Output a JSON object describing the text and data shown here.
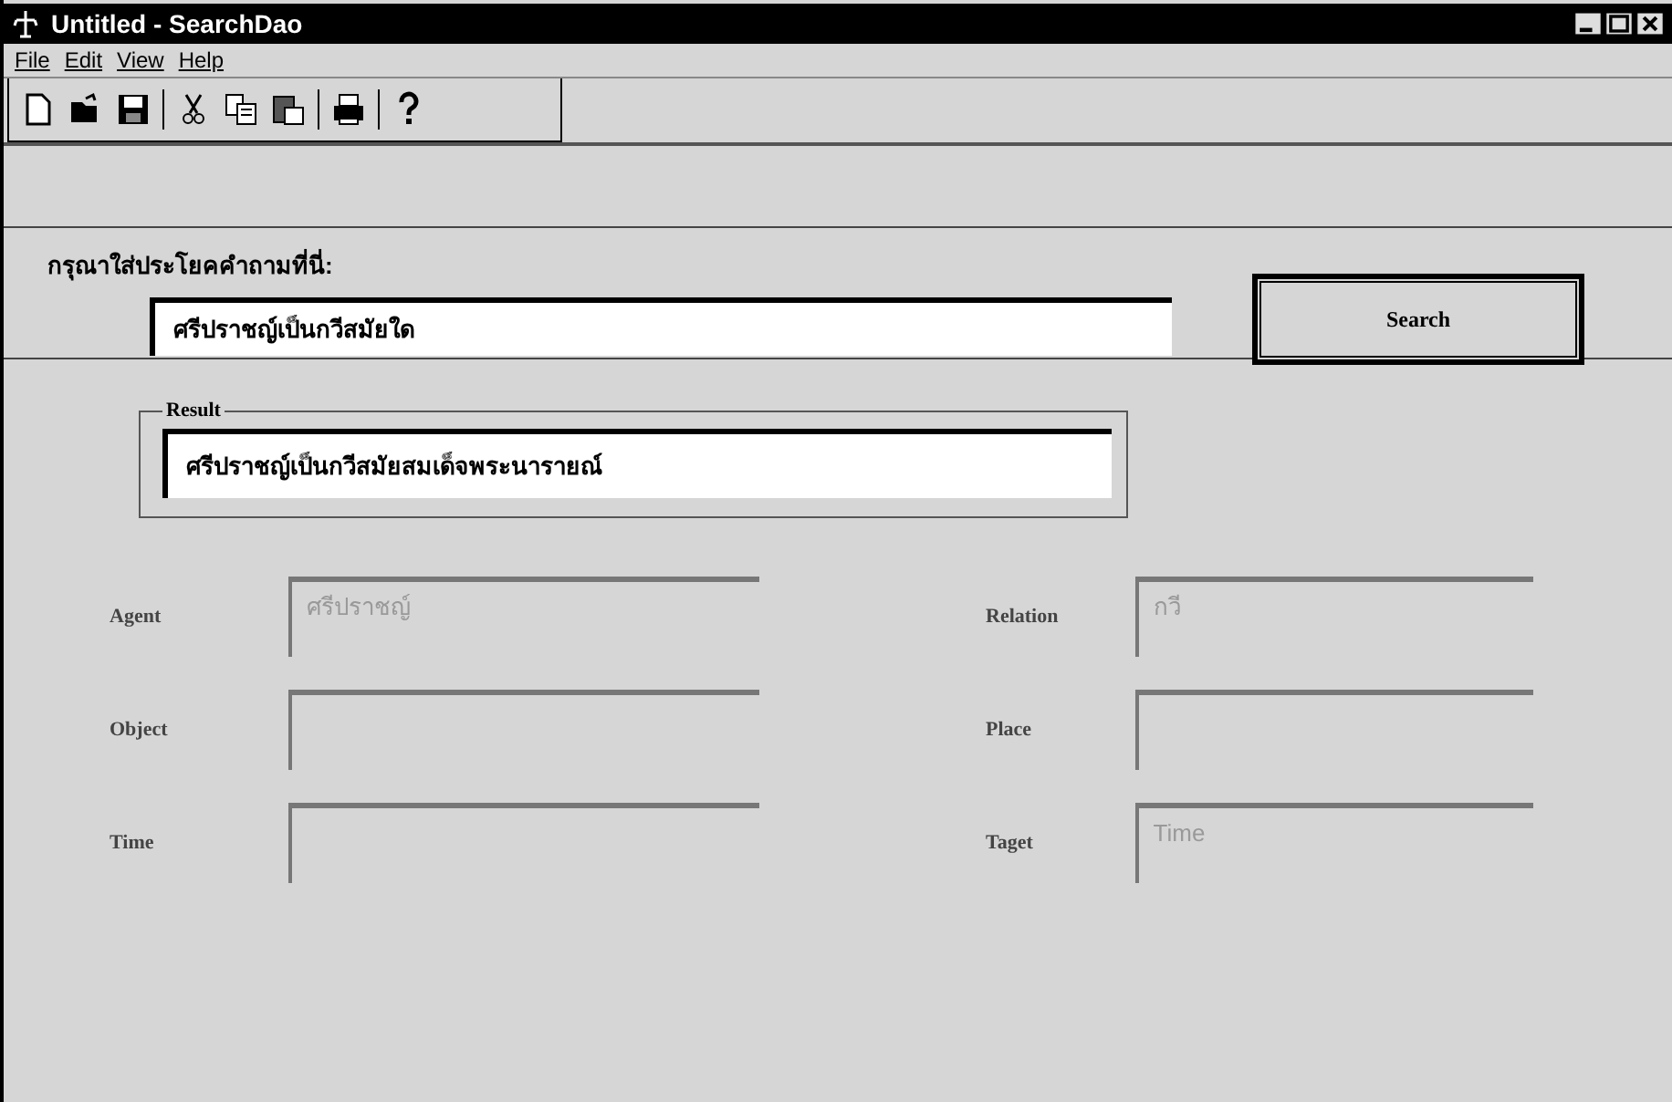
{
  "window": {
    "title": "Untitled - SearchDao"
  },
  "menu": [
    "File",
    "Edit",
    "View",
    "Help"
  ],
  "query": {
    "label": "กรุณาใส่ประโยคคำถามที่นี่:",
    "value": "ศรีปราชญ์เป็นกวีสมัยใด",
    "button": "Search"
  },
  "result": {
    "legend": "Result",
    "value": "ศรีปราชญ์เป็นกวีสมัยสมเด็จพระนารายณ์"
  },
  "fields": [
    {
      "label": "Agent",
      "value": "ศรีปราชญ์",
      "disabled": true
    },
    {
      "label": "Relation",
      "value": "กวี",
      "disabled": true
    },
    {
      "label": "Object",
      "disabled": true
    },
    {
      "label": "Place",
      "disabled": true
    },
    {
      "label": "Time",
      "disabled": true
    },
    {
      "label": "Taget",
      "value": "Time",
      "disabled": true
    }
  ]
}
